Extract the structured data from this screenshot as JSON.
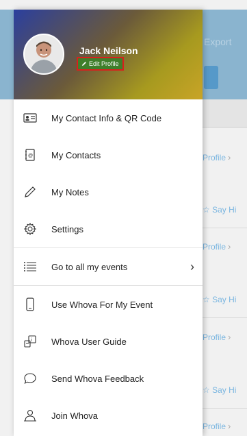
{
  "background": {
    "export_label": "Export",
    "rows": [
      {
        "label": "Profile"
      },
      {
        "label": "Say Hi"
      },
      {
        "label": "Profile"
      },
      {
        "label": "Say Hi"
      },
      {
        "label": "Profile"
      },
      {
        "label": "Say Hi"
      },
      {
        "label": "Profile"
      }
    ]
  },
  "profile": {
    "name": "Jack Neilson",
    "edit_label": "Edit Profile"
  },
  "menu": {
    "items": [
      {
        "label": "My Contact Info & QR Code",
        "icon": "contact-card-icon"
      },
      {
        "label": "My Contacts",
        "icon": "address-book-icon"
      },
      {
        "label": "My Notes",
        "icon": "pencil-icon"
      },
      {
        "label": "Settings",
        "icon": "gear-icon"
      },
      {
        "label": "Go to all my events",
        "icon": "list-icon"
      },
      {
        "label": "Use Whova For My Event",
        "icon": "phone-icon"
      },
      {
        "label": "Whova User Guide",
        "icon": "guide-icon"
      },
      {
        "label": "Send Whova Feedback",
        "icon": "chat-bubble-icon"
      },
      {
        "label": "Join Whova",
        "icon": "person-join-icon"
      }
    ]
  },
  "colors": {
    "accent_blue": "#3b8bc6",
    "edit_highlight": "#d9201c"
  }
}
